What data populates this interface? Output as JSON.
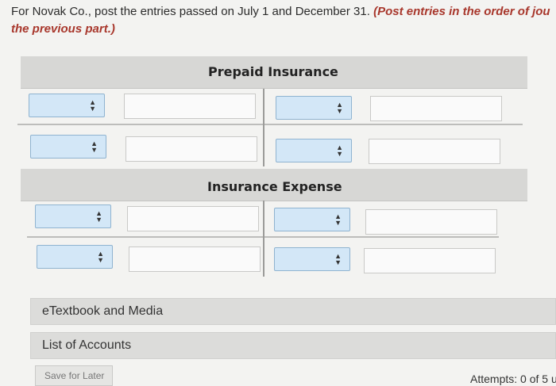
{
  "instructions": {
    "text": "For Novak Co., post the entries passed on July 1 and December 31. ",
    "emphasis": "(Post entries in the order of jou",
    "emphasis_line2": "the previous part.)"
  },
  "accounts": [
    {
      "title": "Prepaid Insurance"
    },
    {
      "title": "Insurance Expense"
    }
  ],
  "links": {
    "etextbook": "eTextbook and Media",
    "list_of_accounts": "List of Accounts"
  },
  "footer": {
    "save_label": "Save for Later",
    "attempts": "Attempts: 0 of 5 u"
  },
  "icons": {
    "select_arrows": "up-down-arrows-icon"
  }
}
